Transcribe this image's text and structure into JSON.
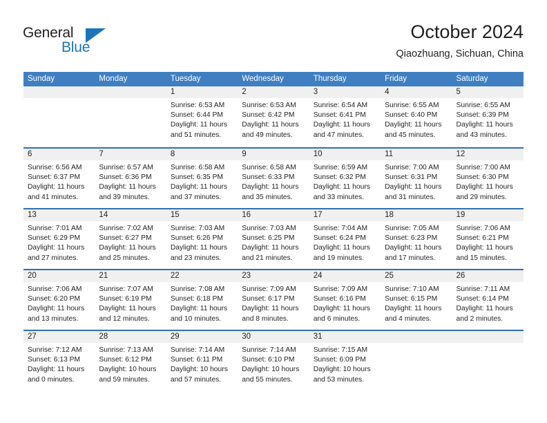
{
  "brand": {
    "name_part1": "General",
    "name_part2": "Blue",
    "accent_color": "#1b75bc",
    "triangle_icon": "triangle-icon"
  },
  "header": {
    "title": "October 2024",
    "subtitle": "Qiaozhuang, Sichuan, China"
  },
  "calendar": {
    "header_bg": "#3f7fc1",
    "daynum_band_bg": "#f0f0f0",
    "row_divider_color": "#2f6fb2",
    "day_names": [
      "Sunday",
      "Monday",
      "Tuesday",
      "Wednesday",
      "Thursday",
      "Friday",
      "Saturday"
    ],
    "weeks": [
      [
        {
          "day": "",
          "lines": []
        },
        {
          "day": "",
          "lines": []
        },
        {
          "day": "1",
          "lines": [
            "Sunrise: 6:53 AM",
            "Sunset: 6:44 PM",
            "Daylight: 11 hours",
            "and 51 minutes."
          ]
        },
        {
          "day": "2",
          "lines": [
            "Sunrise: 6:53 AM",
            "Sunset: 6:42 PM",
            "Daylight: 11 hours",
            "and 49 minutes."
          ]
        },
        {
          "day": "3",
          "lines": [
            "Sunrise: 6:54 AM",
            "Sunset: 6:41 PM",
            "Daylight: 11 hours",
            "and 47 minutes."
          ]
        },
        {
          "day": "4",
          "lines": [
            "Sunrise: 6:55 AM",
            "Sunset: 6:40 PM",
            "Daylight: 11 hours",
            "and 45 minutes."
          ]
        },
        {
          "day": "5",
          "lines": [
            "Sunrise: 6:55 AM",
            "Sunset: 6:39 PM",
            "Daylight: 11 hours",
            "and 43 minutes."
          ]
        }
      ],
      [
        {
          "day": "6",
          "lines": [
            "Sunrise: 6:56 AM",
            "Sunset: 6:37 PM",
            "Daylight: 11 hours",
            "and 41 minutes."
          ]
        },
        {
          "day": "7",
          "lines": [
            "Sunrise: 6:57 AM",
            "Sunset: 6:36 PM",
            "Daylight: 11 hours",
            "and 39 minutes."
          ]
        },
        {
          "day": "8",
          "lines": [
            "Sunrise: 6:58 AM",
            "Sunset: 6:35 PM",
            "Daylight: 11 hours",
            "and 37 minutes."
          ]
        },
        {
          "day": "9",
          "lines": [
            "Sunrise: 6:58 AM",
            "Sunset: 6:33 PM",
            "Daylight: 11 hours",
            "and 35 minutes."
          ]
        },
        {
          "day": "10",
          "lines": [
            "Sunrise: 6:59 AM",
            "Sunset: 6:32 PM",
            "Daylight: 11 hours",
            "and 33 minutes."
          ]
        },
        {
          "day": "11",
          "lines": [
            "Sunrise: 7:00 AM",
            "Sunset: 6:31 PM",
            "Daylight: 11 hours",
            "and 31 minutes."
          ]
        },
        {
          "day": "12",
          "lines": [
            "Sunrise: 7:00 AM",
            "Sunset: 6:30 PM",
            "Daylight: 11 hours",
            "and 29 minutes."
          ]
        }
      ],
      [
        {
          "day": "13",
          "lines": [
            "Sunrise: 7:01 AM",
            "Sunset: 6:29 PM",
            "Daylight: 11 hours",
            "and 27 minutes."
          ]
        },
        {
          "day": "14",
          "lines": [
            "Sunrise: 7:02 AM",
            "Sunset: 6:27 PM",
            "Daylight: 11 hours",
            "and 25 minutes."
          ]
        },
        {
          "day": "15",
          "lines": [
            "Sunrise: 7:03 AM",
            "Sunset: 6:26 PM",
            "Daylight: 11 hours",
            "and 23 minutes."
          ]
        },
        {
          "day": "16",
          "lines": [
            "Sunrise: 7:03 AM",
            "Sunset: 6:25 PM",
            "Daylight: 11 hours",
            "and 21 minutes."
          ]
        },
        {
          "day": "17",
          "lines": [
            "Sunrise: 7:04 AM",
            "Sunset: 6:24 PM",
            "Daylight: 11 hours",
            "and 19 minutes."
          ]
        },
        {
          "day": "18",
          "lines": [
            "Sunrise: 7:05 AM",
            "Sunset: 6:23 PM",
            "Daylight: 11 hours",
            "and 17 minutes."
          ]
        },
        {
          "day": "19",
          "lines": [
            "Sunrise: 7:06 AM",
            "Sunset: 6:21 PM",
            "Daylight: 11 hours",
            "and 15 minutes."
          ]
        }
      ],
      [
        {
          "day": "20",
          "lines": [
            "Sunrise: 7:06 AM",
            "Sunset: 6:20 PM",
            "Daylight: 11 hours",
            "and 13 minutes."
          ]
        },
        {
          "day": "21",
          "lines": [
            "Sunrise: 7:07 AM",
            "Sunset: 6:19 PM",
            "Daylight: 11 hours",
            "and 12 minutes."
          ]
        },
        {
          "day": "22",
          "lines": [
            "Sunrise: 7:08 AM",
            "Sunset: 6:18 PM",
            "Daylight: 11 hours",
            "and 10 minutes."
          ]
        },
        {
          "day": "23",
          "lines": [
            "Sunrise: 7:09 AM",
            "Sunset: 6:17 PM",
            "Daylight: 11 hours",
            "and 8 minutes."
          ]
        },
        {
          "day": "24",
          "lines": [
            "Sunrise: 7:09 AM",
            "Sunset: 6:16 PM",
            "Daylight: 11 hours",
            "and 6 minutes."
          ]
        },
        {
          "day": "25",
          "lines": [
            "Sunrise: 7:10 AM",
            "Sunset: 6:15 PM",
            "Daylight: 11 hours",
            "and 4 minutes."
          ]
        },
        {
          "day": "26",
          "lines": [
            "Sunrise: 7:11 AM",
            "Sunset: 6:14 PM",
            "Daylight: 11 hours",
            "and 2 minutes."
          ]
        }
      ],
      [
        {
          "day": "27",
          "lines": [
            "Sunrise: 7:12 AM",
            "Sunset: 6:13 PM",
            "Daylight: 11 hours",
            "and 0 minutes."
          ]
        },
        {
          "day": "28",
          "lines": [
            "Sunrise: 7:13 AM",
            "Sunset: 6:12 PM",
            "Daylight: 10 hours",
            "and 59 minutes."
          ]
        },
        {
          "day": "29",
          "lines": [
            "Sunrise: 7:14 AM",
            "Sunset: 6:11 PM",
            "Daylight: 10 hours",
            "and 57 minutes."
          ]
        },
        {
          "day": "30",
          "lines": [
            "Sunrise: 7:14 AM",
            "Sunset: 6:10 PM",
            "Daylight: 10 hours",
            "and 55 minutes."
          ]
        },
        {
          "day": "31",
          "lines": [
            "Sunrise: 7:15 AM",
            "Sunset: 6:09 PM",
            "Daylight: 10 hours",
            "and 53 minutes."
          ]
        },
        {
          "day": "",
          "lines": []
        },
        {
          "day": "",
          "lines": []
        }
      ]
    ]
  }
}
